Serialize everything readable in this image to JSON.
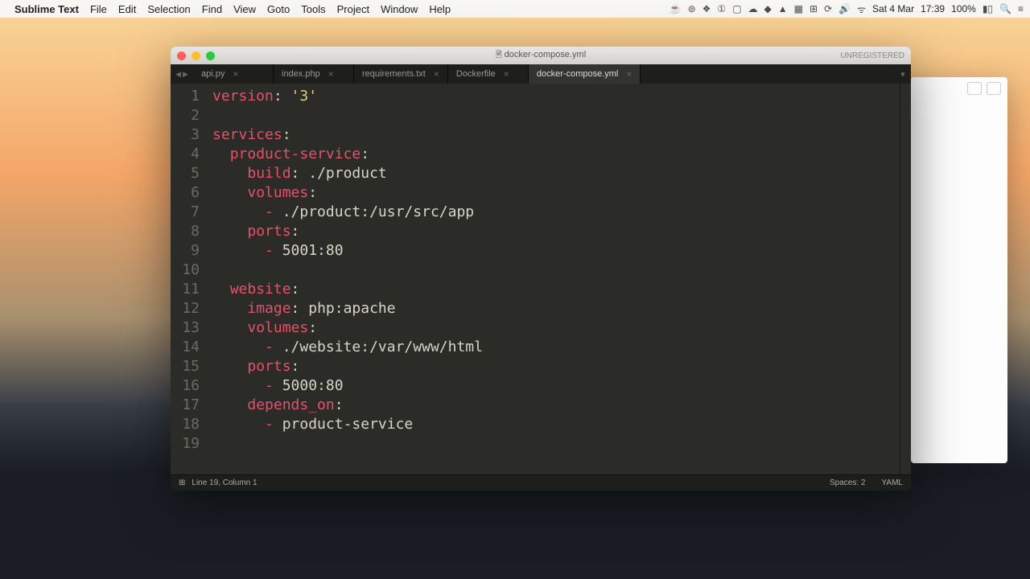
{
  "menubar": {
    "app": "Sublime Text",
    "items": [
      "File",
      "Edit",
      "Selection",
      "Find",
      "View",
      "Goto",
      "Tools",
      "Project",
      "Window",
      "Help"
    ],
    "right": {
      "date": "Sat 4 Mar",
      "time": "17:39",
      "battery": "100%"
    }
  },
  "window": {
    "title": "docker-compose.yml",
    "unregistered": "UNREGISTERED"
  },
  "tabs": [
    {
      "label": "api.py",
      "active": false
    },
    {
      "label": "index.php",
      "active": false
    },
    {
      "label": "requirements.txt",
      "active": false
    },
    {
      "label": "Dockerfile",
      "active": false
    },
    {
      "label": "docker-compose.yml",
      "active": true
    }
  ],
  "code": {
    "lines": [
      {
        "n": 1,
        "seg": [
          [
            "key",
            "version"
          ],
          [
            "pun",
            ":"
          ],
          [
            "pun",
            " "
          ],
          [
            "str",
            "'3'"
          ]
        ]
      },
      {
        "n": 2,
        "seg": []
      },
      {
        "n": 3,
        "seg": [
          [
            "key",
            "services"
          ],
          [
            "pun",
            ":"
          ]
        ]
      },
      {
        "n": 4,
        "seg": [
          [
            "pun",
            "  "
          ],
          [
            "key",
            "product-service"
          ],
          [
            "pun",
            ":"
          ]
        ]
      },
      {
        "n": 5,
        "seg": [
          [
            "pun",
            "    "
          ],
          [
            "key",
            "build"
          ],
          [
            "pun",
            ":"
          ],
          [
            "pun",
            " ./product"
          ]
        ]
      },
      {
        "n": 6,
        "seg": [
          [
            "pun",
            "    "
          ],
          [
            "key",
            "volumes"
          ],
          [
            "pun",
            ":"
          ]
        ]
      },
      {
        "n": 7,
        "seg": [
          [
            "pun",
            "      "
          ],
          [
            "dash",
            "-"
          ],
          [
            "pun",
            " ./product:/usr/src/app"
          ]
        ]
      },
      {
        "n": 8,
        "seg": [
          [
            "pun",
            "    "
          ],
          [
            "key",
            "ports"
          ],
          [
            "pun",
            ":"
          ]
        ]
      },
      {
        "n": 9,
        "seg": [
          [
            "pun",
            "      "
          ],
          [
            "dash",
            "-"
          ],
          [
            "pun",
            " 5001:80"
          ]
        ]
      },
      {
        "n": 10,
        "seg": []
      },
      {
        "n": 11,
        "seg": [
          [
            "pun",
            "  "
          ],
          [
            "key",
            "website"
          ],
          [
            "pun",
            ":"
          ]
        ]
      },
      {
        "n": 12,
        "seg": [
          [
            "pun",
            "    "
          ],
          [
            "key",
            "image"
          ],
          [
            "pun",
            ":"
          ],
          [
            "pun",
            " php:apache"
          ]
        ]
      },
      {
        "n": 13,
        "seg": [
          [
            "pun",
            "    "
          ],
          [
            "key",
            "volumes"
          ],
          [
            "pun",
            ":"
          ]
        ]
      },
      {
        "n": 14,
        "seg": [
          [
            "pun",
            "      "
          ],
          [
            "dash",
            "-"
          ],
          [
            "pun",
            " ./website:/var/www/html"
          ]
        ]
      },
      {
        "n": 15,
        "seg": [
          [
            "pun",
            "    "
          ],
          [
            "key",
            "ports"
          ],
          [
            "pun",
            ":"
          ]
        ]
      },
      {
        "n": 16,
        "seg": [
          [
            "pun",
            "      "
          ],
          [
            "dash",
            "-"
          ],
          [
            "pun",
            " 5000:80"
          ]
        ]
      },
      {
        "n": 17,
        "seg": [
          [
            "pun",
            "    "
          ],
          [
            "key",
            "depends_on"
          ],
          [
            "pun",
            ":"
          ]
        ]
      },
      {
        "n": 18,
        "seg": [
          [
            "pun",
            "      "
          ],
          [
            "dash",
            "-"
          ],
          [
            "pun",
            " product-service"
          ]
        ]
      },
      {
        "n": 19,
        "seg": []
      }
    ]
  },
  "statusbar": {
    "position": "Line 19, Column 1",
    "spaces": "Spaces: 2",
    "syntax": "YAML"
  }
}
